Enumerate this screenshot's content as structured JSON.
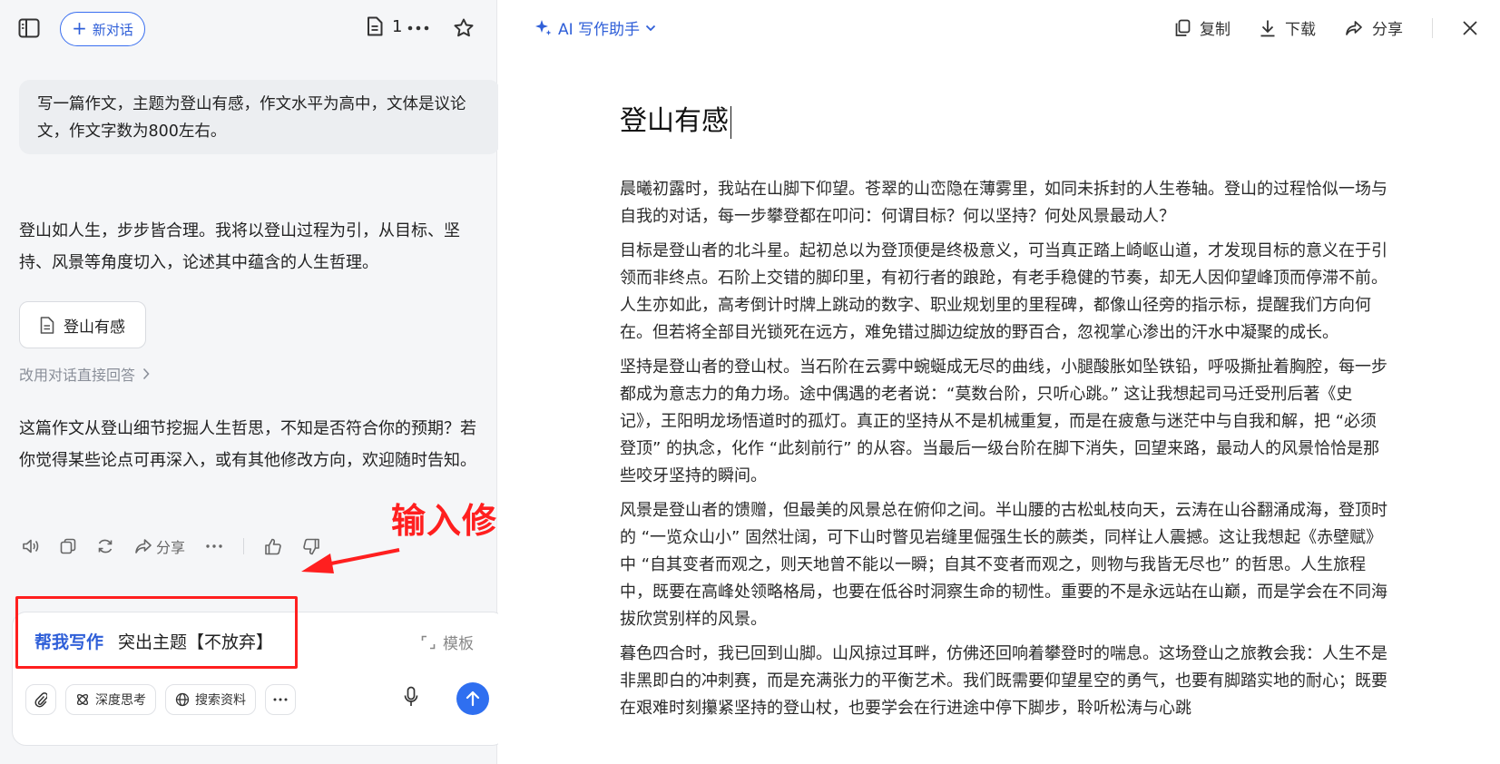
{
  "topbar": {
    "new_chat_label": "新对话",
    "doc_count": "1"
  },
  "conversation": {
    "user_prompt": "写一篇作文，主题为登山有感，作文水平为高中，文体是议论文，作文字数为800左右。",
    "reply_intro": "登山如人生，步步皆合理。我将以登山过程为引，从目标、坚持、风景等角度切入，论述其中蕴含的人生哲理。",
    "doc_chip_label": "登山有感",
    "switch_link": "改用对话直接回答",
    "reply_followup": "这篇作文从登山细节挖掘人生哲思，不知是否符合你的预期？若你觉得某些论点可再深入，或有其他修改方向，欢迎随时告知。",
    "share_label": "分享"
  },
  "annotation": {
    "text": "输入修改想法",
    "color": "#ff1f1f"
  },
  "composer": {
    "mode_label": "帮我写作",
    "input_value": "突出主题【不放弃】",
    "template_label": "模板",
    "tools": {
      "deep_think": "深度思考",
      "search": "搜索资料"
    }
  },
  "editor": {
    "header_title": "AI 写作助手",
    "copy_label": "复制",
    "download_label": "下载",
    "share_label": "分享",
    "doc_title": "登山有感",
    "paragraphs": [
      "晨曦初露时，我站在山脚下仰望。苍翠的山峦隐在薄雾里，如同未拆封的人生卷轴。登山的过程恰似一场与自我的对话，每一步攀登都在叩问：何谓目标？何以坚持？何处风景最动人？",
      "目标是登山者的北斗星。起初总以为登顶便是终极意义，可当真正踏上崎岖山道，才发现目标的意义在于引领而非终点。石阶上交错的脚印里，有初行者的踉跄，有老手稳健的节奏，却无人因仰望峰顶而停滞不前。人生亦如此，高考倒计时牌上跳动的数字、职业规划里的里程碑，都像山径旁的指示标，提醒我们方向何在。但若将全部目光锁死在远方，难免错过脚边绽放的野百合，忽视掌心渗出的汗水中凝聚的成长。",
      "坚持是登山者的登山杖。当石阶在云雾中蜿蜒成无尽的曲线，小腿酸胀如坠铁铅，呼吸撕扯着胸腔，每一步都成为意志力的角力场。途中偶遇的老者说：“莫数台阶，只听心跳。” 这让我想起司马迁受刑后著《史记》，王阳明龙场悟道时的孤灯。真正的坚持从不是机械重复，而是在疲惫与迷茫中与自我和解，把 “必须登顶” 的执念，化作 “此刻前行” 的从容。当最后一级台阶在脚下消失，回望来路，最动人的风景恰恰是那些咬牙坚持的瞬间。",
      "风景是登山者的馈赠，但最美的风景总在俯仰之间。半山腰的古松虬枝向天，云涛在山谷翻涌成海，登顶时的 “一览众山小” 固然壮阔，可下山时瞥见岩缝里倔强生长的蕨类，同样让人震撼。这让我想起《赤壁赋》中 “自其变者而观之，则天地曾不能以一瞬；自其不变者而观之，则物与我皆无尽也” 的哲思。人生旅程中，既要在高峰处领略格局，也要在低谷时洞察生命的韧性。重要的不是永远站在山巅，而是学会在不同海拔欣赏别样的风景。",
      "暮色四合时，我已回到山脚。山风掠过耳畔，仿佛还回响着攀登时的喘息。这场登山之旅教会我：人生不是非黑即白的冲刺赛，而是充满张力的平衡艺术。我们既需要仰望星空的勇气，也要有脚踏实地的耐心；既要在艰难时刻攥紧坚持的登山杖，也要学会在行进途中停下脚步，聆听松涛与心跳"
    ]
  },
  "colors": {
    "accent": "#2f5fd8",
    "send_button": "#2f6ff0",
    "left_bg": "#f5f6f8"
  }
}
